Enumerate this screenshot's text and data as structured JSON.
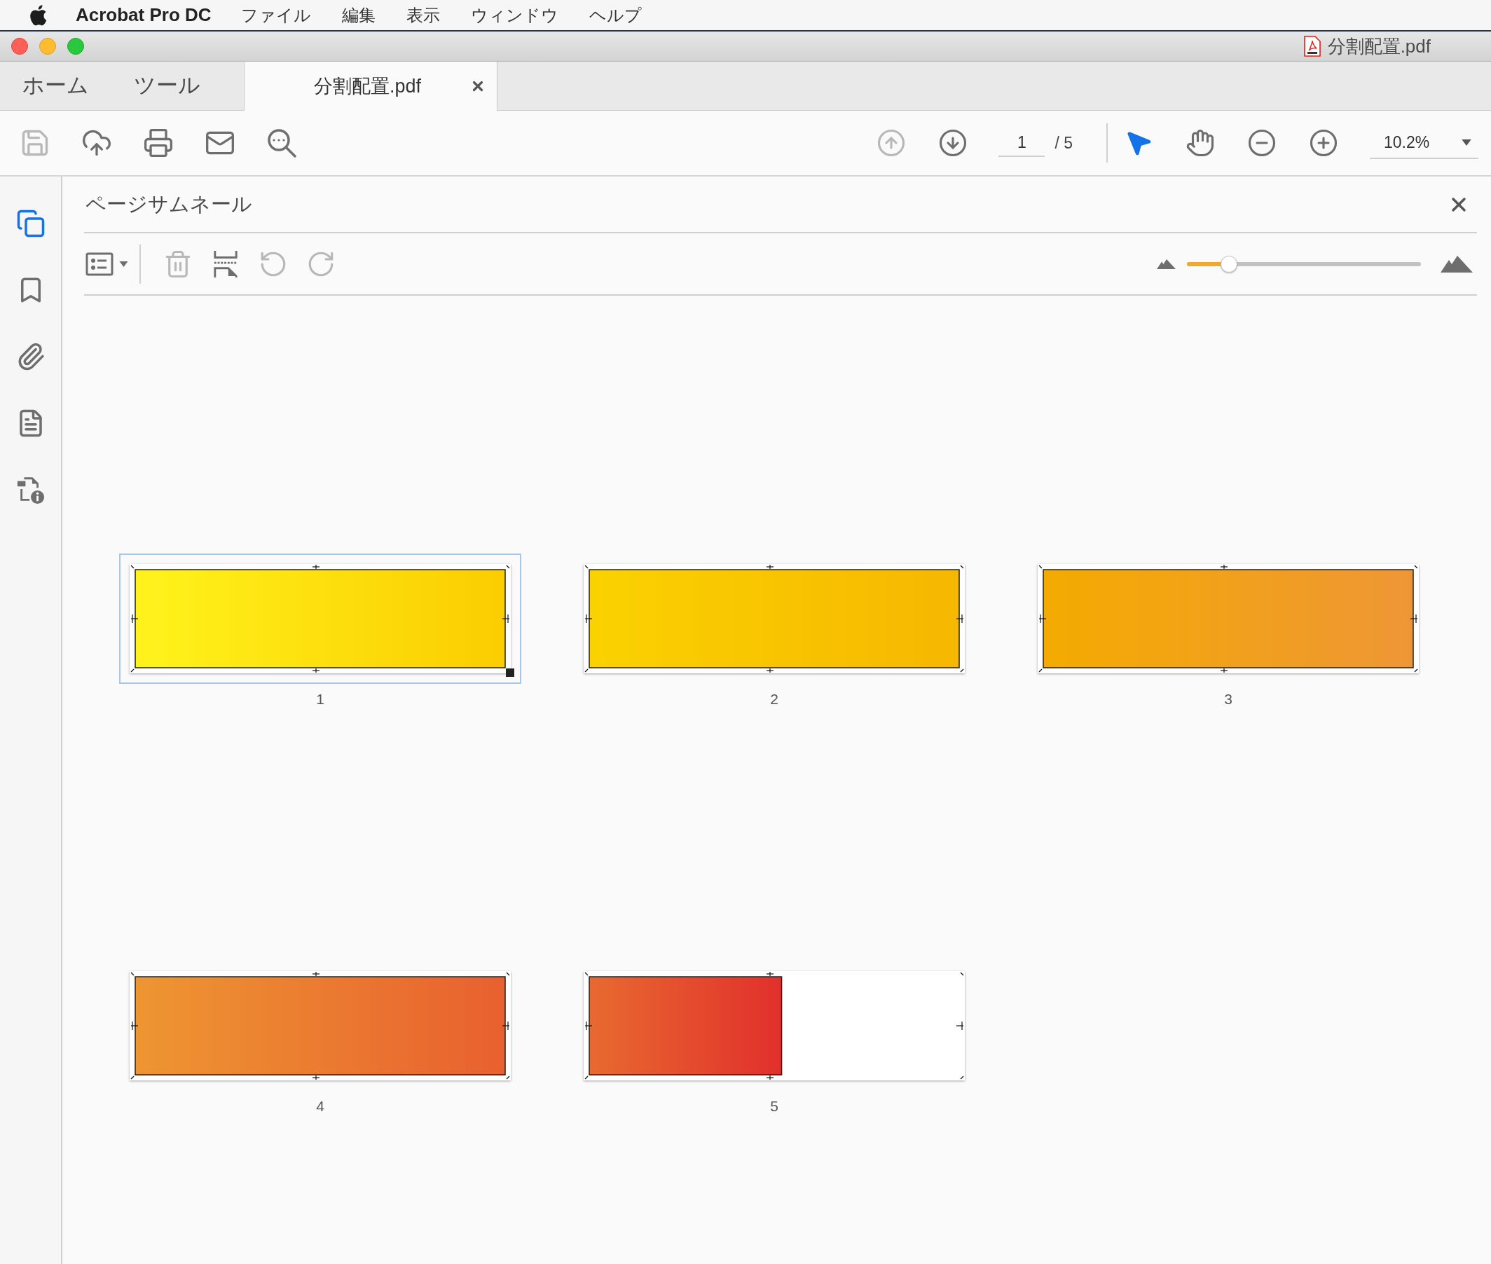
{
  "menu_bar": {
    "app_name": "Acrobat Pro DC",
    "items": [
      "ファイル",
      "編集",
      "表示",
      "ウィンドウ",
      "ヘルプ"
    ]
  },
  "window": {
    "title": "分割配置.pdf"
  },
  "tabs": [
    {
      "label": "ホーム",
      "kind": "nav",
      "selected": false
    },
    {
      "label": "ツール",
      "kind": "nav",
      "selected": false
    },
    {
      "label": "分割配置.pdf",
      "kind": "document",
      "selected": true
    }
  ],
  "toolbar": {
    "actions": [
      {
        "kind": "save",
        "disabled": true
      },
      {
        "kind": "upload",
        "disabled": false
      },
      {
        "kind": "print",
        "disabled": false
      },
      {
        "kind": "email",
        "disabled": false
      },
      {
        "kind": "find",
        "disabled": false
      }
    ],
    "navigation": [
      {
        "kind": "previous",
        "disabled": true
      },
      {
        "kind": "next",
        "disabled": false
      }
    ],
    "page_number": "1",
    "page_total": "/ 5",
    "tools": [
      {
        "kind": "select",
        "selected": true
      },
      {
        "kind": "hand",
        "selected": false
      },
      {
        "kind": "zoom_out",
        "selected": false
      },
      {
        "kind": "zoom_in",
        "selected": false
      }
    ],
    "zoom": "10.2%"
  },
  "side_rail": [
    {
      "kind": "pages",
      "selected": true
    },
    {
      "kind": "bookmarks",
      "selected": false
    },
    {
      "kind": "attachments",
      "selected": false
    },
    {
      "kind": "content",
      "selected": false
    },
    {
      "kind": "properties",
      "selected": false
    }
  ],
  "panel": {
    "title": "ページサムネール",
    "actions": [
      {
        "kind": "delete",
        "disabled": true
      },
      {
        "kind": "split",
        "disabled": false
      },
      {
        "kind": "rotate_left",
        "disabled": true
      },
      {
        "kind": "rotate_right",
        "disabled": true
      }
    ],
    "thumbnail_size": {
      "level": 0.18
    },
    "thumbnails": [
      {
        "label": "1",
        "selected": true
      },
      {
        "label": "2",
        "selected": false
      },
      {
        "label": "3",
        "selected": false
      },
      {
        "label": "4",
        "selected": false
      },
      {
        "label": "5",
        "selected": false
      }
    ]
  }
}
